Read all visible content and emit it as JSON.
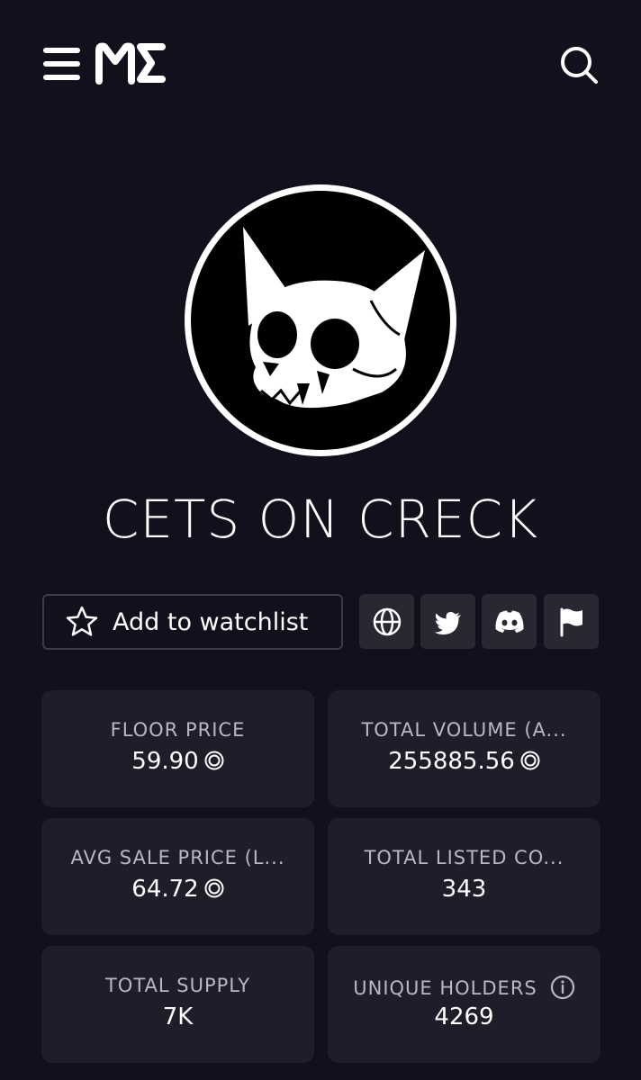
{
  "header": {
    "logo_text": "ME",
    "menu_icon": "hamburger-menu-icon",
    "search_icon": "search-icon"
  },
  "collection": {
    "name": "CETS ON CRECK",
    "avatar_icon": "cat-skull-logo"
  },
  "actions": {
    "watchlist_label": "Add to watchlist",
    "watchlist_icon": "star-icon",
    "links": [
      "globe-icon",
      "twitter-icon",
      "discord-icon",
      "flag-icon"
    ]
  },
  "stats": [
    {
      "label": "FLOOR PRICE",
      "value": "59.90",
      "currency": "sol-icon"
    },
    {
      "label": "TOTAL VOLUME (A...",
      "value": "255885.56",
      "currency": "sol-icon"
    },
    {
      "label": "AVG SALE PRICE (L...",
      "value": "64.72",
      "currency": "sol-icon"
    },
    {
      "label": "TOTAL LISTED CO...",
      "value": "343"
    },
    {
      "label": "TOTAL SUPPLY",
      "value": "7K"
    },
    {
      "label": "UNIQUE HOLDERS",
      "value": "4269",
      "info_icon": "info-icon"
    }
  ],
  "colors": {
    "background": "#130f1c",
    "card": "#201d2b",
    "button": "#2a2733",
    "label": "#bab6c4"
  }
}
